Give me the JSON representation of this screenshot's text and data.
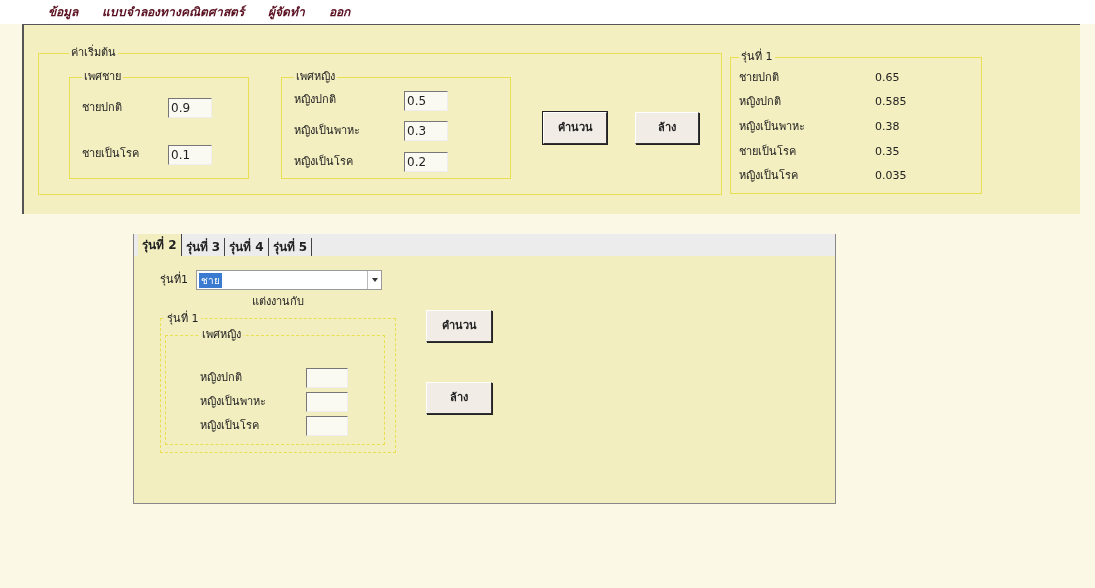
{
  "menu": [
    {
      "label": "ข้อมูล"
    },
    {
      "label": "แบบจำลองทางคณิตศาสตร์"
    },
    {
      "label": "ผู้จัดทำ"
    },
    {
      "label": "ออก"
    }
  ],
  "initial": {
    "title": "ค่าเริ่มต้น",
    "male": {
      "title": "เพศชาย",
      "fields": [
        {
          "label": "ชายปกติ",
          "value": "0.9"
        },
        {
          "label": "ชายเป็นโรค",
          "value": "0.1"
        }
      ]
    },
    "female": {
      "title": "เพศหญิง",
      "fields": [
        {
          "label": "หญิงปกติ",
          "value": "0.5"
        },
        {
          "label": "หญิงเป็นพาหะ",
          "value": "0.3"
        },
        {
          "label": "หญิงเป็นโรค",
          "value": "0.2"
        }
      ]
    },
    "buttons": [
      {
        "label": "คำนวน",
        "default": true
      },
      {
        "label": "ล้าง",
        "default": false
      }
    ]
  },
  "result": {
    "title": "รุ่นที่ 1",
    "rows": [
      {
        "label": "ชายปกติ",
        "value": "0.65"
      },
      {
        "label": "หญิงปกติ",
        "value": "0.585"
      },
      {
        "label": "หญิงเป็นพาหะ",
        "value": "0.38"
      },
      {
        "label": "ชายเป็นโรค",
        "value": "0.35"
      },
      {
        "label": "หญิงเป็นโรค",
        "value": "0.035"
      }
    ]
  },
  "tabs": [
    {
      "label": "รุ่นที่ 2",
      "selected": true
    },
    {
      "label": "รุ่นที่ 3",
      "selected": false
    },
    {
      "label": "รุ่นที่ 4",
      "selected": false
    },
    {
      "label": "รุ่นที่ 5",
      "selected": false
    }
  ],
  "tab_panel": {
    "combo_label": "รุ่นที่1",
    "combo_value": "ชาย",
    "married_label": "แต่งงานกับ",
    "group_title": "รุ่นที่ 1",
    "sub_title": "เพศหญิง",
    "fields": [
      {
        "label": "หญิงปกติ"
      },
      {
        "label": "หญิงเป็นพาหะ"
      },
      {
        "label": "หญิงเป็นโรค"
      }
    ],
    "buttons": [
      {
        "label": "คำนวน"
      },
      {
        "label": "ล้าง"
      }
    ]
  }
}
